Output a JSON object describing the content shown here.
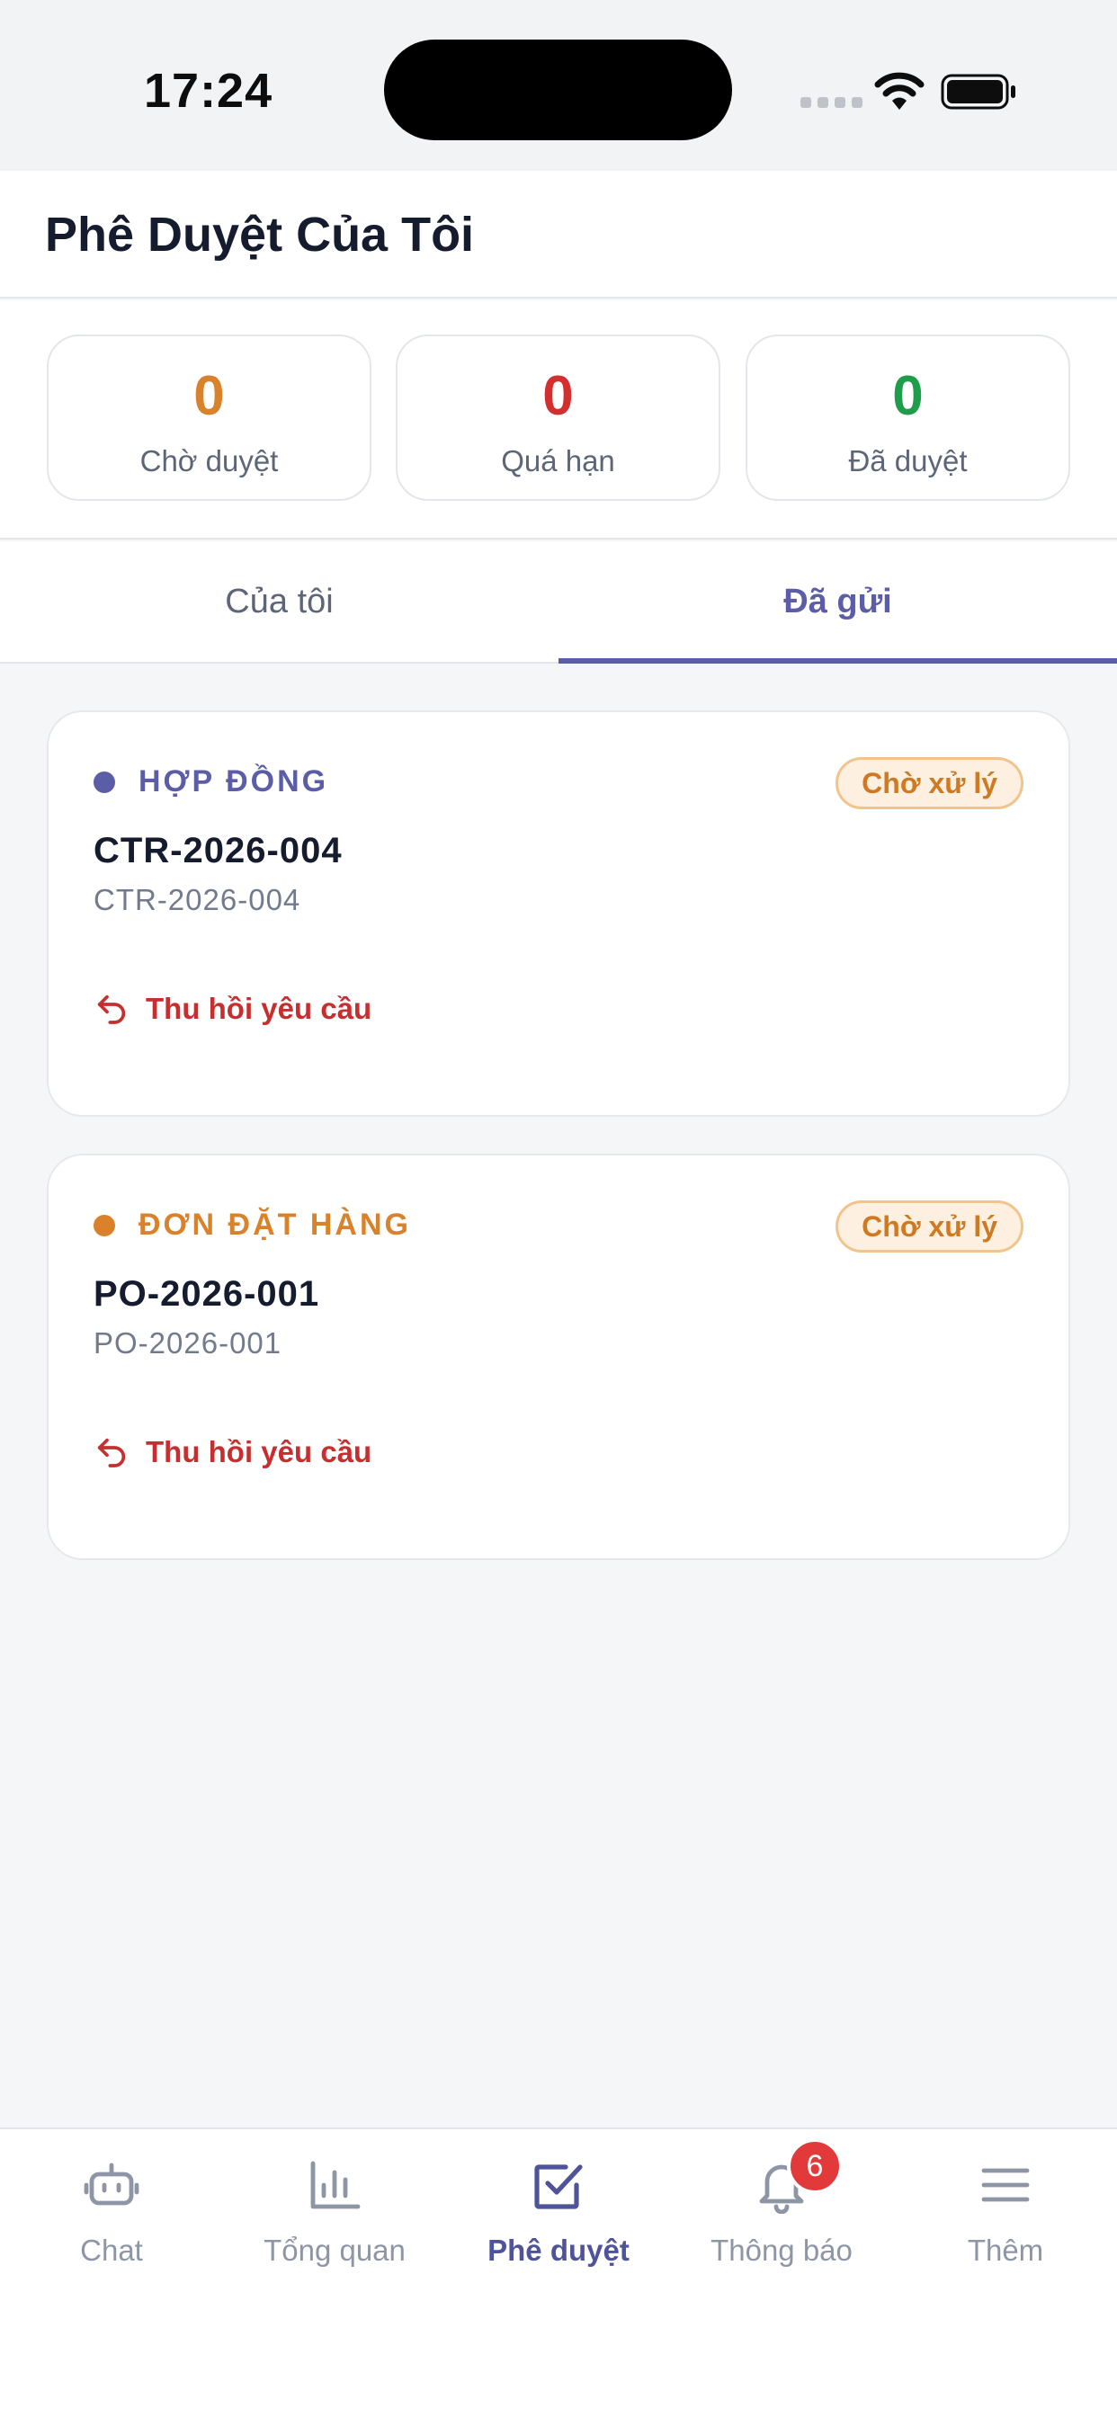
{
  "status_bar": {
    "time": "17:24"
  },
  "header": {
    "title": "Phê Duyệt Của Tôi"
  },
  "stats": [
    {
      "value": "0",
      "label": "Chờ duyệt",
      "color": "#d9822b"
    },
    {
      "value": "0",
      "label": "Quá hạn",
      "color": "#d32f2f"
    },
    {
      "value": "0",
      "label": "Đã duyệt",
      "color": "#1e9e4a"
    }
  ],
  "tabs": [
    {
      "label": "Của tôi",
      "active": false
    },
    {
      "label": "Đã gửi",
      "active": true
    }
  ],
  "requests": [
    {
      "type": "HỢP ĐỒNG",
      "type_color": "#5b5ea6",
      "status": "Chờ xử lý",
      "code": "CTR-2026-004",
      "subtitle": "CTR-2026-004",
      "action": "Thu hồi yêu cầu"
    },
    {
      "type": "ĐƠN ĐẶT HÀNG",
      "type_color": "#d9822b",
      "status": "Chờ xử lý",
      "code": "PO-2026-001",
      "subtitle": "PO-2026-001",
      "action": "Thu hồi yêu cầu"
    }
  ],
  "bottom_nav": [
    {
      "label": "Chat",
      "icon": "robot-icon",
      "active": false
    },
    {
      "label": "Tổng quan",
      "icon": "bar-chart-icon",
      "active": false
    },
    {
      "label": "Phê duyệt",
      "icon": "check-square-icon",
      "active": true
    },
    {
      "label": "Thông báo",
      "icon": "bell-icon",
      "active": false,
      "badge": "6"
    },
    {
      "label": "Thêm",
      "icon": "menu-icon",
      "active": false
    }
  ]
}
